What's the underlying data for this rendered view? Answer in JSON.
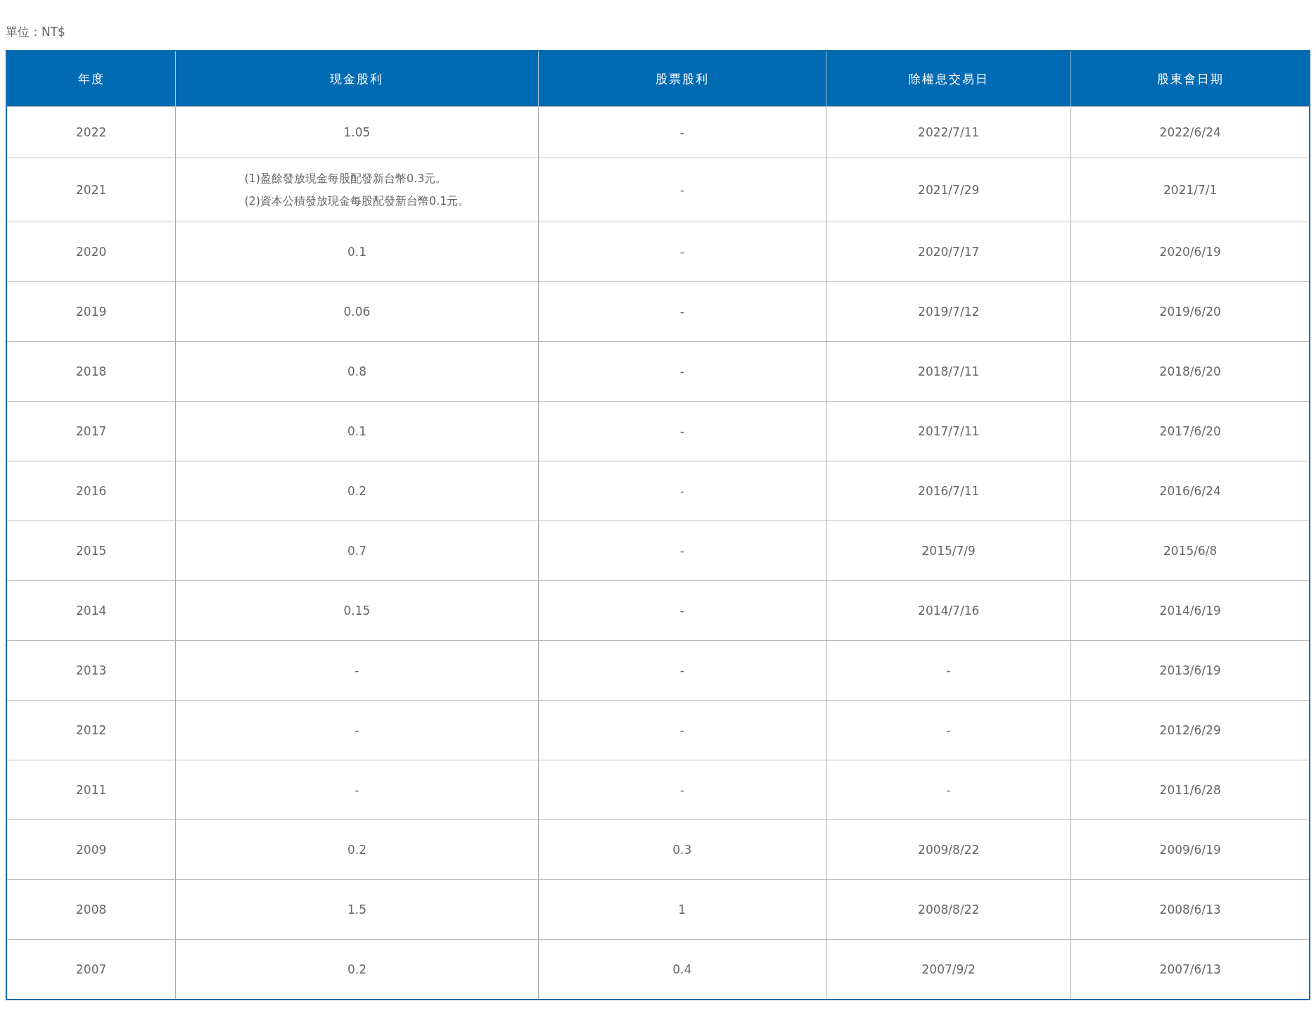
{
  "unit_label": "單位：NT$",
  "table": {
    "columns": [
      "年度",
      "現金股利",
      "股票股利",
      "除權息交易日",
      "股東會日期"
    ],
    "rows": [
      {
        "cells": [
          "2022",
          "1.05",
          "-",
          "2022/7/11",
          "2022/6/24"
        ]
      },
      {
        "cells": [
          "2021",
          [
            "(1)盈餘發放現金每股配發新台幣0.3元。",
            "(2)資本公積發放現金每股配發新台幣0.1元。"
          ],
          "-",
          "2021/7/29",
          "2021/7/1"
        ]
      },
      {
        "cells": [
          "2020",
          "0.1",
          "-",
          "2020/7/17",
          "2020/6/19"
        ]
      },
      {
        "cells": [
          "2019",
          "0.06",
          "-",
          "2019/7/12",
          "2019/6/20"
        ]
      },
      {
        "cells": [
          "2018",
          "0.8",
          "-",
          "2018/7/11",
          "2018/6/20"
        ]
      },
      {
        "cells": [
          "2017",
          "0.1",
          "-",
          "2017/7/11",
          "2017/6/20"
        ]
      },
      {
        "cells": [
          "2016",
          "0.2",
          "-",
          "2016/7/11",
          "2016/6/24"
        ]
      },
      {
        "cells": [
          "2015",
          "0.7",
          "-",
          "2015/7/9",
          "2015/6/8"
        ]
      },
      {
        "cells": [
          "2014",
          "0.15",
          "-",
          "2014/7/16",
          "2014/6/19"
        ]
      },
      {
        "cells": [
          "2013",
          "-",
          "-",
          "-",
          "2013/6/19"
        ]
      },
      {
        "cells": [
          "2012",
          "-",
          "-",
          "-",
          "2012/6/29"
        ]
      },
      {
        "cells": [
          "2011",
          "-",
          "-",
          "-",
          "2011/6/28"
        ]
      },
      {
        "cells": [
          "2009",
          "0.2",
          "0.3",
          "2009/8/22",
          "2009/6/19"
        ]
      },
      {
        "cells": [
          "2008",
          "1.5",
          "1",
          "2008/8/22",
          "2008/6/13"
        ]
      },
      {
        "cells": [
          "2007",
          "0.2",
          "0.4",
          "2007/9/2",
          "2007/6/13"
        ]
      }
    ]
  }
}
